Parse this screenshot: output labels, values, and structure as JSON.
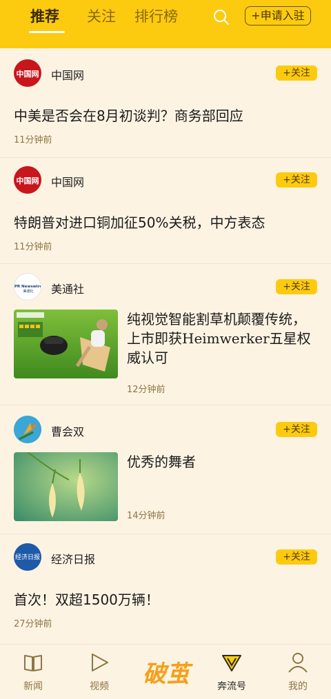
{
  "topbar": {
    "tabs": [
      {
        "label": "推荐",
        "active": true
      },
      {
        "label": "关注",
        "active": false
      },
      {
        "label": "排行榜",
        "active": false
      }
    ],
    "search_icon": "search-icon",
    "apply_label": "+申请入驻"
  },
  "feed": [
    {
      "source": "中国网",
      "follow": "+关注",
      "title": "中美是否会在8月初谈判？商务部回应",
      "time": "11分钟前",
      "avatar_text": "中国网"
    },
    {
      "source": "中国网",
      "follow": "+关注",
      "title": "特朗普对进口铜加征50%关税，中方表态",
      "time": "11分钟前",
      "avatar_text": "中国网"
    },
    {
      "source": "美通社",
      "follow": "+关注",
      "title": "纯视觉智能割草机颠覆传统，上市即获Heimwerker五星权威认可",
      "time": "12分钟前",
      "avatar_text": "PR Newswire 美通社"
    },
    {
      "source": "曹会双",
      "follow": "+关注",
      "title": "优秀的舞者",
      "time": "14分钟前"
    },
    {
      "source": "经济日报",
      "follow": "+关注",
      "title": "首次！双超1500万辆！",
      "time": "27分钟前",
      "avatar_text": "经济日报"
    }
  ],
  "bottom_nav": [
    {
      "label": "新闻",
      "icon": "book-icon"
    },
    {
      "label": "视频",
      "icon": "play-icon"
    },
    {
      "label": "破茧",
      "icon": "pojian-logo"
    },
    {
      "label": "奔流号",
      "icon": "v-diamond-icon"
    },
    {
      "label": "我的",
      "icon": "person-icon"
    }
  ],
  "colors": {
    "brand_yellow": "#fccb10",
    "background": "#fdf3e3",
    "meta_text": "#8d7642"
  }
}
